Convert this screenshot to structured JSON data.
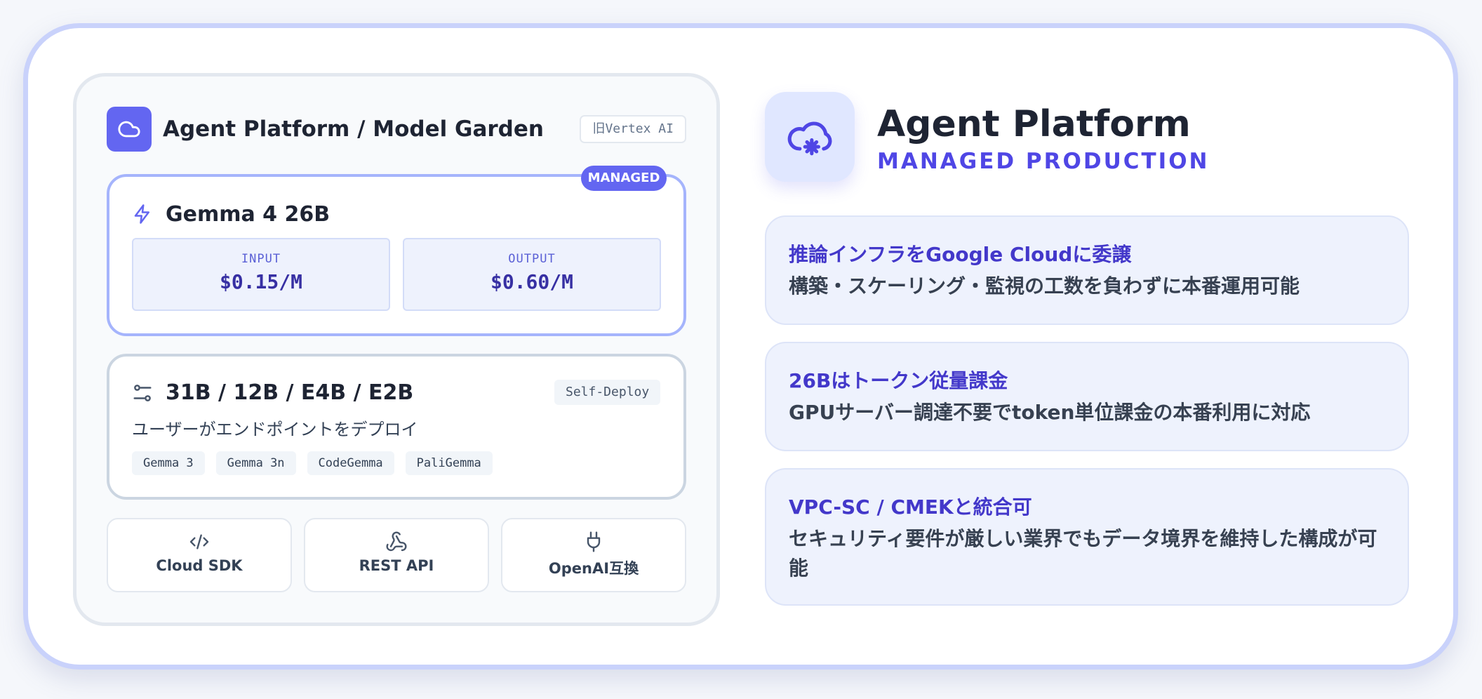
{
  "left": {
    "header": {
      "title": "Agent Platform / Model Garden",
      "tag": "旧Vertex AI",
      "icon": "cloud-icon"
    },
    "managed": {
      "badge": "MANAGED",
      "title": "Gemma 4 26B",
      "icon": "lightning-icon",
      "input_label": "INPUT",
      "input_price": "$0.15/M",
      "output_label": "OUTPUT",
      "output_price": "$0.60/M"
    },
    "self_deploy": {
      "title": "31B / 12B / E4B / E2B",
      "icon": "sliders-icon",
      "tag": "Self-Deploy",
      "subtitle": "ユーザーがエンドポイントをデプロイ",
      "models": [
        "Gemma 3",
        "Gemma 3n",
        "CodeGemma",
        "PaliGemma"
      ]
    },
    "apis": [
      {
        "label": "Cloud SDK",
        "icon": "code-icon"
      },
      {
        "label": "REST API",
        "icon": "webhook-icon"
      },
      {
        "label": "OpenAI互換",
        "icon": "plug-icon"
      }
    ]
  },
  "right": {
    "title": "Agent Platform",
    "subtitle": "MANAGED PRODUCTION",
    "icon": "cloud-gear-icon",
    "features": [
      {
        "title": "推論インフラをGoogle Cloudに委譲",
        "desc": "構築・スケーリング・監視の工数を負わずに本番運用可能"
      },
      {
        "title": "26Bはトークン従量課金",
        "desc": "GPUサーバー調達不要でtoken単位課金の本番利用に対応"
      },
      {
        "title": "VPC-SC / CMEKと統合可",
        "desc": "セキュリティ要件が厳しい業界でもデータ境界を維持した構成が可能"
      }
    ]
  },
  "colors": {
    "accent": "#6366f1",
    "accent_dark": "#4338ca",
    "border": "#c9d2fb",
    "feature_bg": "#eef2fd"
  }
}
